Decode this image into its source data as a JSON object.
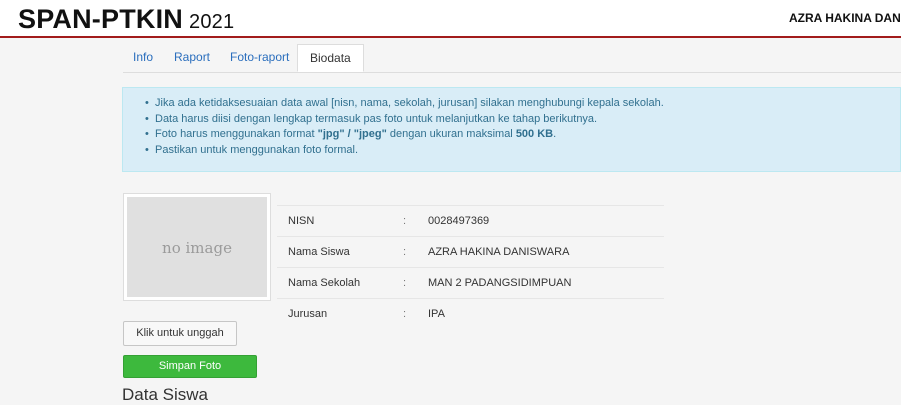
{
  "header": {
    "brand": "SPAN-PTKIN",
    "year": "2021",
    "user": "AZRA HAKINA DANISWARA"
  },
  "tabs": [
    {
      "label": "Info"
    },
    {
      "label": "Raport"
    },
    {
      "label": "Foto-raport"
    },
    {
      "label": "Biodata"
    }
  ],
  "notice": {
    "items": [
      {
        "text": "Jika ada ketidaksesuaian data awal [nisn, nama, sekolah, jurusan] silakan menghubungi kepala sekolah."
      },
      {
        "text": "Data harus diisi dengan lengkap termasuk pas foto untuk melanjutkan ke tahap berikutnya."
      },
      {
        "pre": "Foto harus menggunakan format ",
        "bold1": "\"jpg\" / \"jpeg\"",
        "mid": " dengan ukuran maksimal ",
        "bold2": "500 KB",
        "post": "."
      },
      {
        "text": "Pastikan untuk menggunakan foto formal."
      }
    ]
  },
  "photo": {
    "placeholder": "no image"
  },
  "biodata": [
    {
      "label": "NISN",
      "colon": ":",
      "value": "0028497369"
    },
    {
      "label": "Nama Siswa",
      "colon": ":",
      "value": "AZRA HAKINA DANISWARA"
    },
    {
      "label": "Nama Sekolah",
      "colon": ":",
      "value": "MAN 2 PADANGSIDIMPUAN"
    },
    {
      "label": "Jurusan",
      "colon": ":",
      "value": "IPA"
    }
  ],
  "buttons": {
    "upload": "Klik untuk unggah",
    "save": "Simpan Foto"
  },
  "section": {
    "title": "Data Siswa"
  },
  "colors": {
    "accent_red": "#a21b1b",
    "link_blue": "#2a6ebd",
    "alert_bg": "#d9edf7",
    "alert_text": "#31708f",
    "save_green": "#3db93d"
  }
}
